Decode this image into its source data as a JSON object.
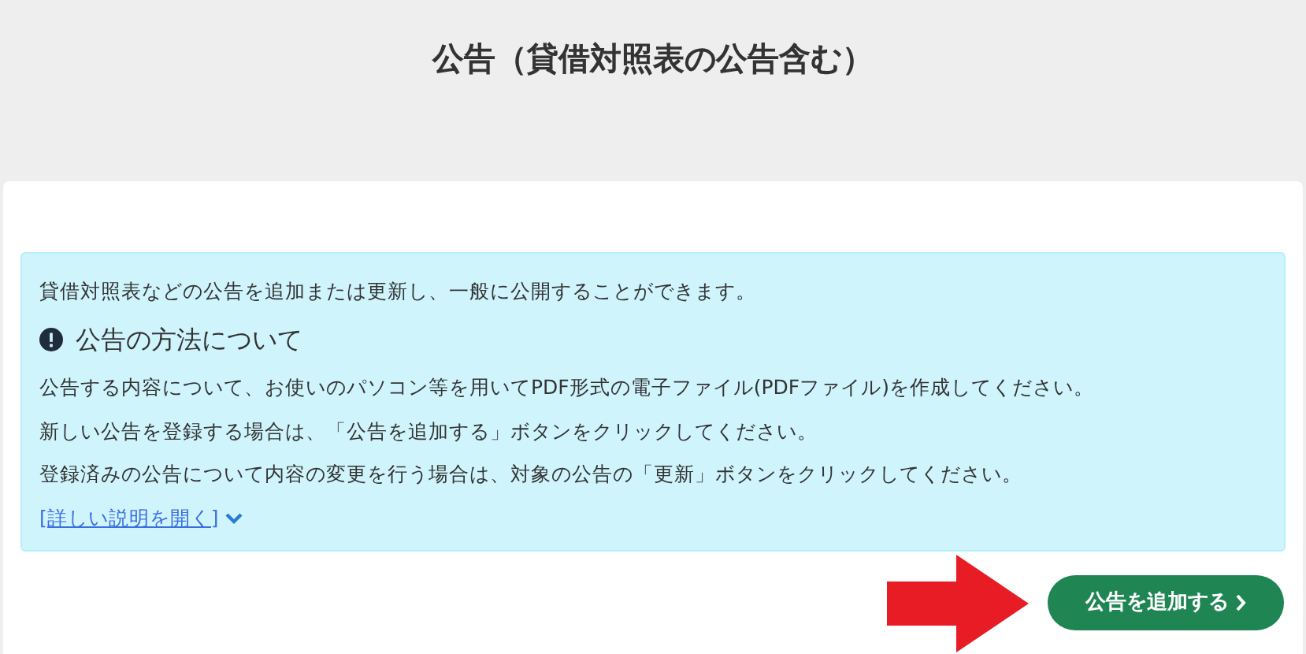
{
  "page_title": "公告（貸借対照表の公告含む）",
  "info": {
    "intro": "貸借対照表などの公告を追加または更新し、一般に公開することができます。",
    "heading": "公告の方法について",
    "lines": [
      "公告する内容について、お使いのパソコン等を用いてPDF形式の電子ファイル(PDFファイル)を作成してください。",
      "新しい公告を登録する場合は、「公告を追加する」ボタンをクリックしてください。",
      "登録済みの公告について内容の変更を行う場合は、対象の公告の「更新」ボタンをクリックしてください。"
    ],
    "details_link": "[詳しい説明を開く]"
  },
  "add_button": "公告を追加する"
}
